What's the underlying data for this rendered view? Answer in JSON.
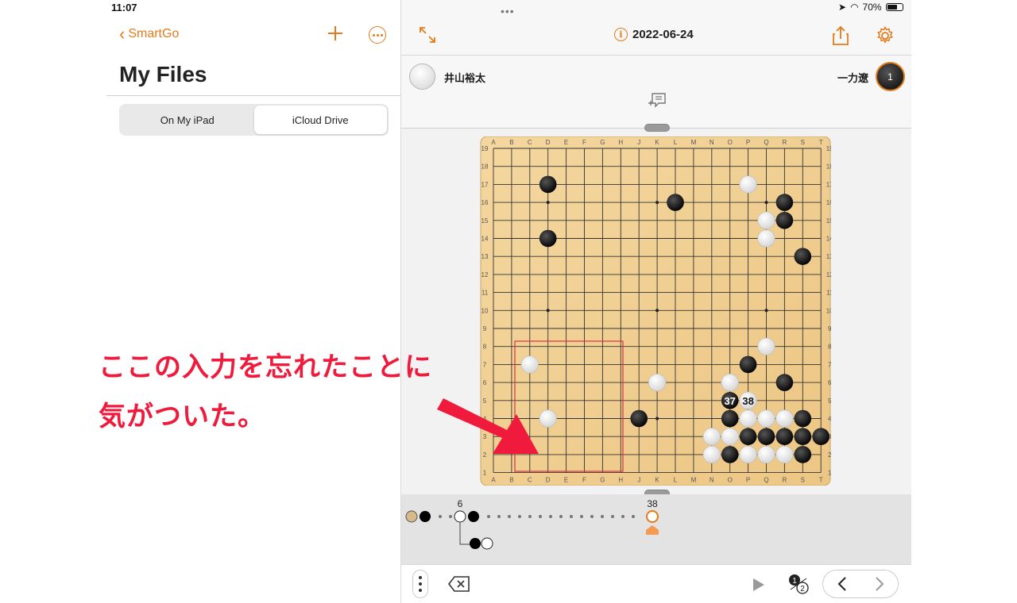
{
  "status": {
    "time": "11:07",
    "battery": "70%"
  },
  "left_panel": {
    "back_label": "SmartGo",
    "title": "My Files",
    "segments": [
      {
        "label": "On My iPad",
        "selected": false
      },
      {
        "label": "iCloud Drive",
        "selected": true
      }
    ],
    "accent": "#e37b1a"
  },
  "annotation": {
    "line1": "ここの入力を忘れたことに",
    "line2": "気がついた。",
    "color": "#f01a3c"
  },
  "game": {
    "date": "2022-06-24",
    "white_player": "井山裕太",
    "black_player": "一力遼",
    "to_play_number": "1",
    "move_numbers": [
      "37",
      "38"
    ],
    "columns": [
      "A",
      "B",
      "C",
      "D",
      "E",
      "F",
      "G",
      "H",
      "J",
      "K",
      "L",
      "M",
      "N",
      "O",
      "P",
      "Q",
      "R",
      "S",
      "T"
    ],
    "rows": [
      "19",
      "18",
      "17",
      "16",
      "15",
      "14",
      "13",
      "12",
      "11",
      "10",
      "9",
      "8",
      "7",
      "6",
      "5",
      "4",
      "3",
      "2",
      "1"
    ]
  },
  "tree": {
    "label_start": "6",
    "label_current": "38"
  },
  "icons": {
    "back": "chevron-left-icon",
    "add": "plus-icon",
    "more": "ellipsis-circle-icon",
    "expand": "expand-arrows-icon",
    "info": "info-icon",
    "share": "share-icon",
    "settings": "gear-icon",
    "comment": "add-comment-icon",
    "delete": "delete-backward-icon",
    "play": "play-icon",
    "numbers": "move-numbers-icon",
    "prev": "chevron-left-icon",
    "next": "chevron-right-icon"
  }
}
